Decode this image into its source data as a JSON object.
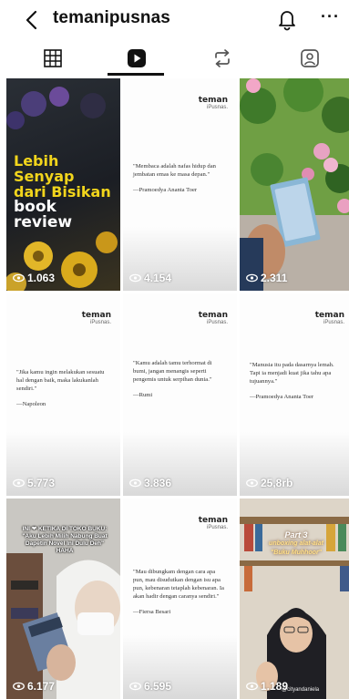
{
  "header": {
    "username": "temanipusnas",
    "back_icon": "chevron-left-icon",
    "notification_icon": "bell-icon",
    "more_label": "···"
  },
  "tabs": [
    {
      "name": "grid",
      "icon": "grid-icon",
      "active": false
    },
    {
      "name": "reels",
      "icon": "reels-icon",
      "active": true
    },
    {
      "name": "reposts",
      "icon": "repost-icon",
      "active": false
    },
    {
      "name": "tagged",
      "icon": "tagged-icon",
      "active": false
    }
  ],
  "posts": [
    {
      "type": "video",
      "overlay_lines": [
        "Lebih",
        "Senyap",
        "dari Bisikan",
        "book",
        "review"
      ],
      "views": "1.063"
    },
    {
      "type": "quote",
      "logo": [
        "teman",
        "iPusnas."
      ],
      "quote": "\"Membaca adalah nafas hidup dan jembatan emas ke masa depan.\"",
      "author": "—Pramoedya Ananta Toer",
      "views": "4.154"
    },
    {
      "type": "video",
      "views": "2.311"
    },
    {
      "type": "quote",
      "logo": [
        "teman",
        "iPusnas."
      ],
      "quote": "\"Jika kamu ingin melakukan sesuatu hal dengan baik, maka lakukanlah sendiri.\"",
      "author": "—Napoleon",
      "views": "5.773"
    },
    {
      "type": "quote",
      "logo": [
        "teman",
        "iPusnas."
      ],
      "quote": "\"Kamu adalah tamu terhormat di bumi, jangan menangis seperti pengemis untuk serpihan dunia.\"",
      "author": "—Rumi",
      "views": "3.836"
    },
    {
      "type": "quote",
      "logo": [
        "teman",
        "iPusnas."
      ],
      "quote": "\"Manusia itu pada dasarnya lemah. Tapi ia menjadi kuat jika tahu apa tujuannya.\"",
      "author": "—Pramoedya Ananta Toer",
      "views": "25,8rb"
    },
    {
      "type": "video",
      "caption": "INI ❤ KETIKA DI TOKO BUKU: \"Aku Lebih Milih Nabung Buat Dapetin Novel Ini Dulu Deh\" HAHA",
      "views": "6.177"
    },
    {
      "type": "quote",
      "logo": [
        "teman",
        "iPusnas."
      ],
      "quote": "\"Mau dibungkam dengan cara apa pun, mau disudutkan dengan isu apa pun, kebenaran tetaplah kebenaran. Ia akan hadir dengan caranya sendiri.\"",
      "author": "—Fiersa Besari",
      "views": "6.595"
    },
    {
      "type": "video",
      "part_label": [
        "Part 3",
        "unboxing alat-alat",
        "\"Buku Muhhoor\""
      ],
      "watermark": "@cityandaniela",
      "views": "1.189"
    }
  ],
  "colors": {
    "accent_yellow": "#f2d51c",
    "text": "#111111"
  }
}
